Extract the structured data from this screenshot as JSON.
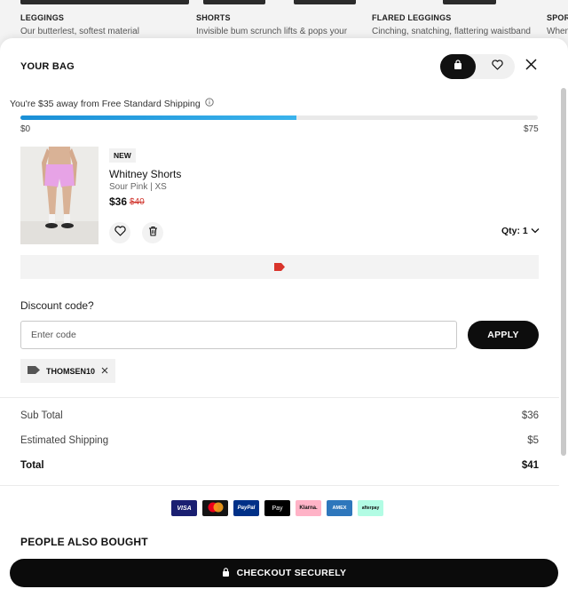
{
  "background_page": {
    "columns": [
      {
        "category": "LEGGINGS",
        "description": "Our butterlest, softest material"
      },
      {
        "category": "SHORTS",
        "description": "Invisible bum scrunch lifts & pops your"
      },
      {
        "category": "FLARED LEGGINGS",
        "description": "Cinching, snatching, flattering waistband"
      },
      {
        "category": "SPOR",
        "description": "When"
      }
    ]
  },
  "bag": {
    "title": "YOUR BAG",
    "bag_icon": "bag-icon",
    "wishlist_icon": "heart-icon",
    "close_icon": "close-icon"
  },
  "shipping": {
    "message": "You're $35 away from Free Standard Shipping",
    "info_icon": "info-icon",
    "progress_fraction": 0.533,
    "min_label": "$0",
    "max_label": "$75"
  },
  "item": {
    "badge": "NEW",
    "name": "Whitney Shorts",
    "variant": "Sour Pink | XS",
    "price": "$36",
    "old_price": "$40",
    "qty_label": "Qty: 1",
    "image_colors": {
      "shorts": "#e7a3e6",
      "skin": "#d9b296",
      "background": "#ecebe8"
    }
  },
  "promo": {
    "tag_icon": "tag-icon",
    "tag_color": "#d9342b"
  },
  "discount": {
    "label": "Discount code?",
    "placeholder": "Enter code",
    "apply_label": "APPLY",
    "applied_code": "THOMSEN10"
  },
  "summary": {
    "subtotal_label": "Sub Total",
    "subtotal_value": "$36",
    "shipping_label": "Estimated Shipping",
    "shipping_value": "$5",
    "total_label": "Total",
    "total_value": "$41"
  },
  "payment_methods": [
    {
      "name": "VISA",
      "bg": "#1a1f71",
      "fg": "#ffffff"
    },
    {
      "name": "",
      "bg": "#141414",
      "fg": "#ffffff",
      "icon": "mastercard-icon"
    },
    {
      "name": "PayPal",
      "bg": "#003087",
      "fg": "#ffffff"
    },
    {
      "name": "Pay",
      "bg": "#000000",
      "fg": "#ffffff",
      "icon": "apple-icon"
    },
    {
      "name": "Klarna.",
      "bg": "#ffb3c7",
      "fg": "#111111"
    },
    {
      "name": "AMEX",
      "bg": "#2e77bc",
      "fg": "#ffffff"
    },
    {
      "name": "afterpay",
      "bg": "#b2fce4",
      "fg": "#111111"
    }
  ],
  "people_also_bought": "PEOPLE ALSO BOUGHT",
  "checkout": {
    "label": "CHECKOUT SECURELY",
    "icon": "lock-icon"
  }
}
